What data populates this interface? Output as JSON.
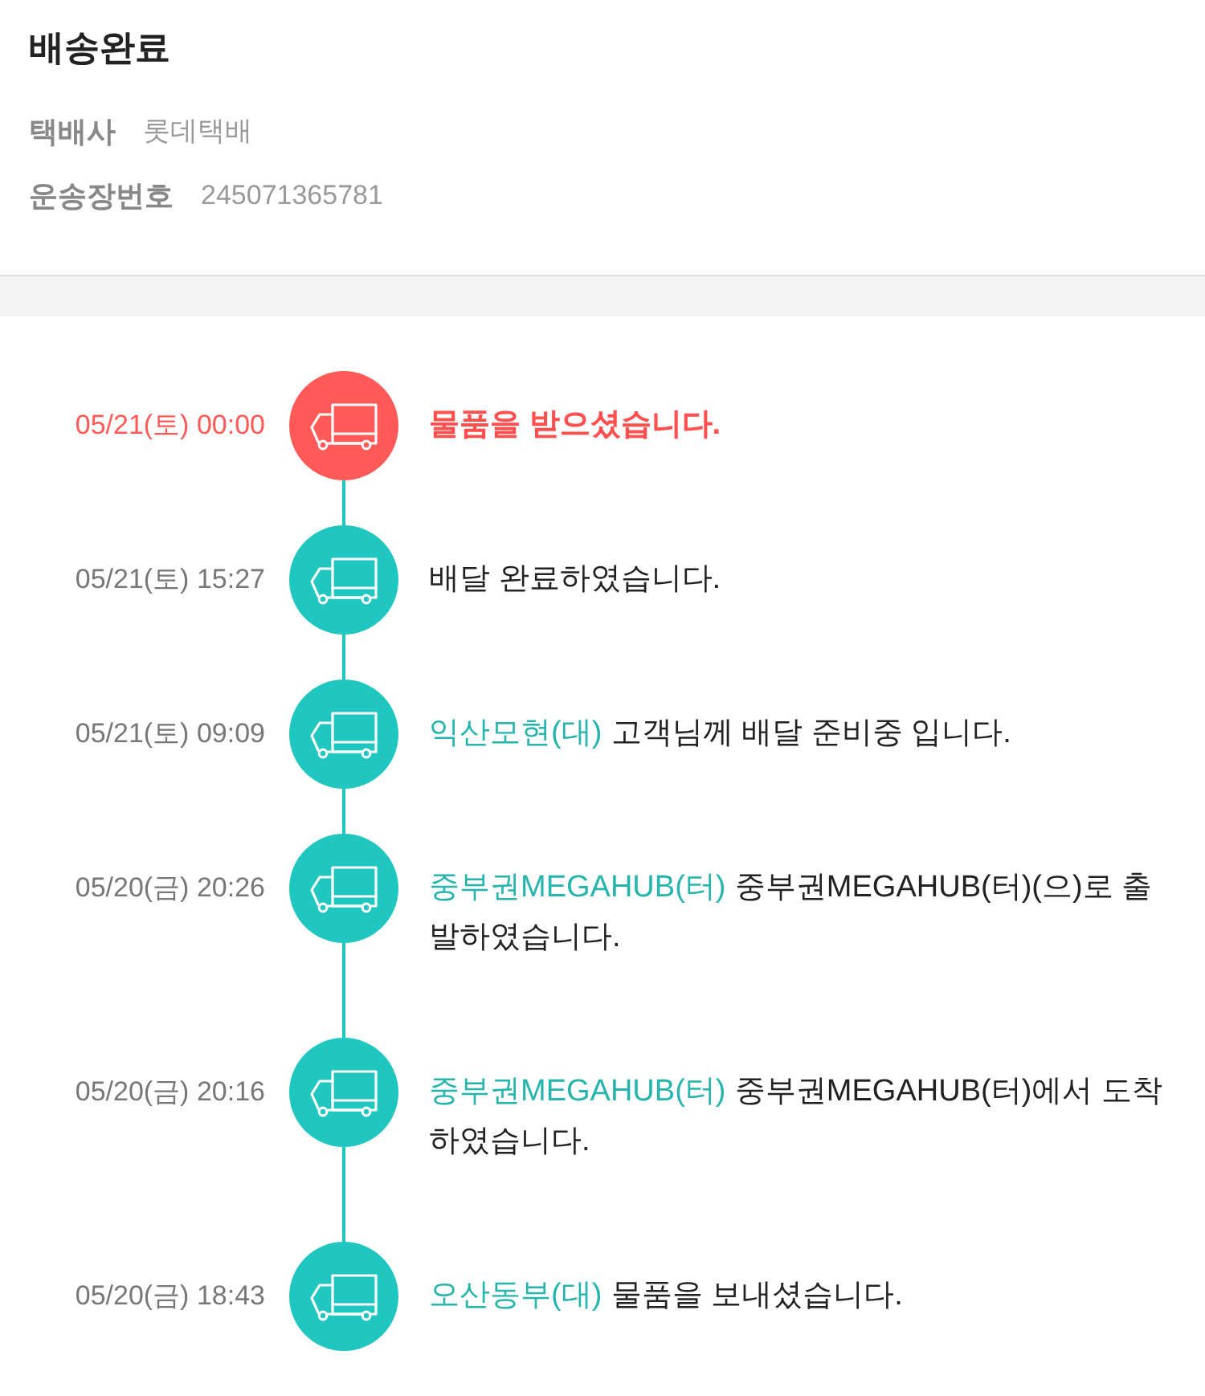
{
  "header": {
    "status": "배송완료",
    "fields": [
      {
        "label": "택배사",
        "value": "롯데택배"
      },
      {
        "label": "운송장번호",
        "value": "245071365781"
      }
    ]
  },
  "events": [
    {
      "time": "05/21(토) 00:00",
      "message": "물품을 받으셨습니다.",
      "highlighted": true
    },
    {
      "time": "05/21(토) 15:27",
      "message": "배달 완료하였습니다.",
      "highlighted": false
    },
    {
      "time": "05/21(토) 09:09",
      "location": "익산모현(대)",
      "message": "고객님께 배달 준비중 입니다.",
      "highlighted": false
    },
    {
      "time": "05/20(금) 20:26",
      "location": "중부권MEGAHUB(터)",
      "message": "중부권MEGAHUB(터)(으)로 출발하였습니다.",
      "highlighted": false
    },
    {
      "time": "05/20(금) 20:16",
      "location": "중부권MEGAHUB(터)",
      "message": "중부권MEGAHUB(터)에서 도착하였습니다.",
      "highlighted": false
    },
    {
      "time": "05/20(금) 18:43",
      "location": "오산동부(대)",
      "message": "물품을 보내셨습니다.",
      "highlighted": false
    }
  ]
}
